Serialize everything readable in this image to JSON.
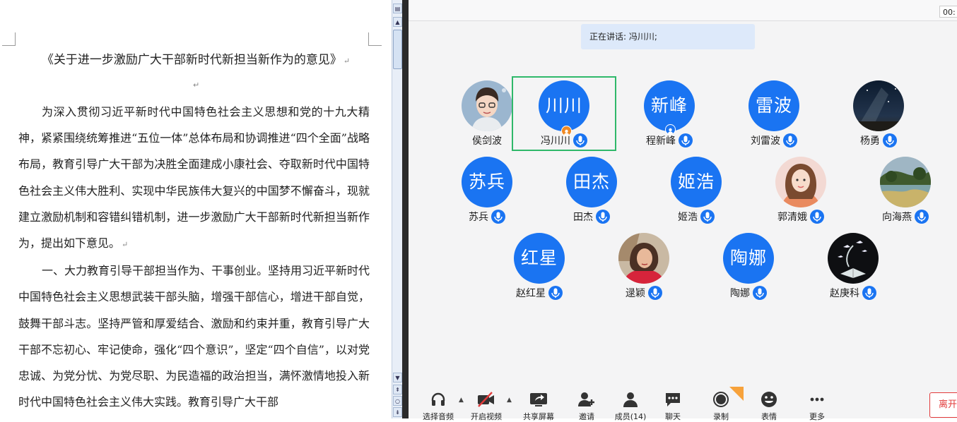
{
  "document": {
    "title": "《关于进一步激励广大干部新时代新担当新作为的意见》",
    "paragraph_mark": "↵",
    "paragraphs": [
      "为深入贯彻习近平新时代中国特色社会主义思想和党的十九大精神，紧紧围绕统筹推进“五位一体”总体布局和协调推进“四个全面”战略布局，教育引导广大干部为决胜全面建成小康社会、夺取新时代中国特色社会主义伟大胜利、实现中华民族伟大复兴的中国梦不懈奋斗，现就建立激励机制和容错纠错机制，进一步激励广大干部新时代新担当新作为，提出如下意见。",
      "一、大力教育引导干部担当作为、干事创业。坚持用习近平新时代中国特色社会主义思想武装干部头脑，增强干部信心，增进干部自觉，鼓舞干部斗志。坚持严管和厚爱结合、激励和约束并重，教育引导广大干部不忘初心、牢记使命，强化“四个意识”，坚定“四个自信”，以对党忠诚、为党分忧、为党尽职、为民造福的政治担当，满怀激情地投入新时代中国特色社会主义伟大实践。教育引导广大干部"
    ]
  },
  "meeting": {
    "timer": "00:",
    "speaking_label": "正在讲话: 冯川川;",
    "participants": [
      {
        "name": "侯剑波",
        "avatar_type": "photo-cartoon-man",
        "avatar_text": "",
        "mic": false,
        "active": false,
        "badge": ""
      },
      {
        "name": "冯川川",
        "avatar_type": "text",
        "avatar_text": "川川",
        "mic": true,
        "active": true,
        "badge": "host"
      },
      {
        "name": "程新峰",
        "avatar_type": "text",
        "avatar_text": "新峰",
        "mic": true,
        "active": false,
        "badge": "cohost"
      },
      {
        "name": "刘雷波",
        "avatar_type": "text",
        "avatar_text": "雷波",
        "mic": true,
        "active": false,
        "badge": ""
      },
      {
        "name": "杨勇",
        "avatar_type": "photo-night-sky",
        "avatar_text": "",
        "mic": true,
        "active": false,
        "badge": ""
      },
      {
        "name": "苏兵",
        "avatar_type": "text",
        "avatar_text": "苏兵",
        "mic": true,
        "active": false,
        "badge": ""
      },
      {
        "name": "田杰",
        "avatar_type": "text",
        "avatar_text": "田杰",
        "mic": true,
        "active": false,
        "badge": ""
      },
      {
        "name": "姬浩",
        "avatar_type": "text",
        "avatar_text": "姬浩",
        "mic": true,
        "active": false,
        "badge": ""
      },
      {
        "name": "郭清娥",
        "avatar_type": "photo-cartoon-woman",
        "avatar_text": "",
        "mic": true,
        "active": false,
        "badge": ""
      },
      {
        "name": "向海燕",
        "avatar_type": "photo-landscape",
        "avatar_text": "",
        "mic": true,
        "active": false,
        "badge": ""
      },
      {
        "name": "赵红星",
        "avatar_type": "text",
        "avatar_text": "红星",
        "mic": true,
        "active": false,
        "badge": ""
      },
      {
        "name": "逯颖",
        "avatar_type": "photo-woman",
        "avatar_text": "",
        "mic": true,
        "active": false,
        "badge": ""
      },
      {
        "name": "陶娜",
        "avatar_type": "text",
        "avatar_text": "陶娜",
        "mic": true,
        "active": false,
        "badge": ""
      },
      {
        "name": "赵庚科",
        "avatar_type": "photo-birds-book",
        "avatar_text": "",
        "mic": true,
        "active": false,
        "badge": ""
      }
    ],
    "toolbar": {
      "audio": "选择音频",
      "video": "开启视频",
      "share": "共享屏幕",
      "invite": "邀请",
      "members": "成员(14)",
      "chat": "聊天",
      "record": "录制",
      "reactions": "表情",
      "more": "更多",
      "leave": "离开"
    }
  },
  "colors": {
    "accent_blue": "#1a74f2",
    "active_border": "#2fb86a",
    "speaking_bg": "#dde9fa",
    "leave_red": "#e23b3b"
  }
}
